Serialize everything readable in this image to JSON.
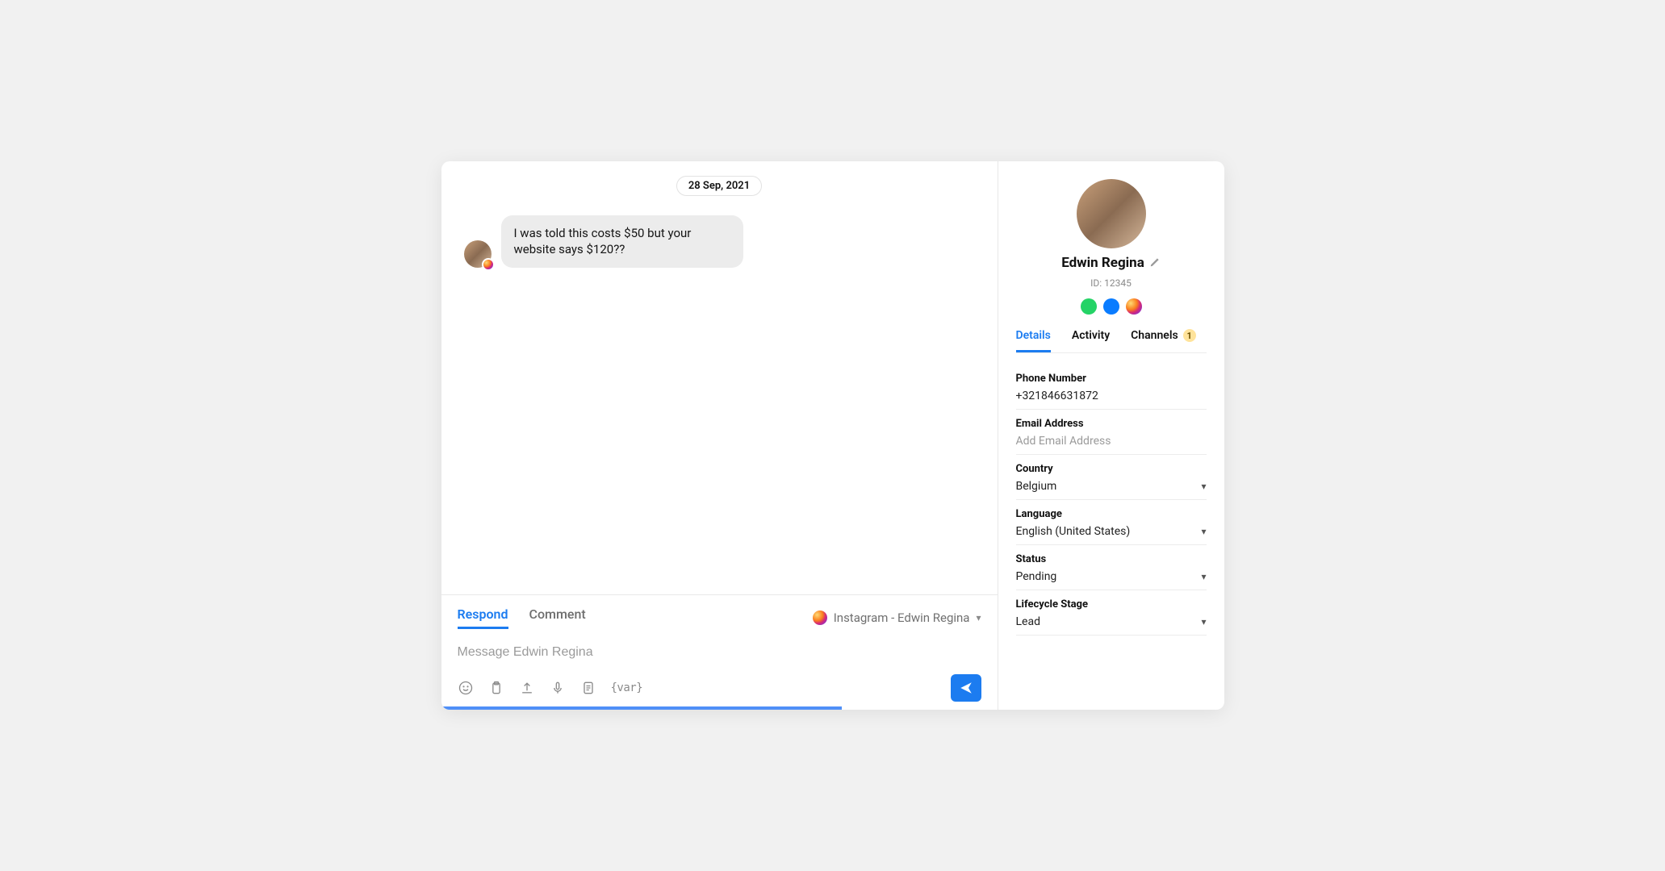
{
  "conversation": {
    "date": "28 Sep, 2021",
    "messages": [
      {
        "text": "I was told this costs $50 but your website says $120??",
        "source": "instagram"
      }
    ]
  },
  "composer": {
    "tabs": {
      "respond": "Respond",
      "comment": "Comment"
    },
    "active_tab": "respond",
    "channel_label": "Instagram - Edwin Regina",
    "placeholder": "Message Edwin Regina",
    "var_token": "{var}"
  },
  "contact": {
    "name": "Edwin Regina",
    "id_label": "ID: 12345",
    "channels": [
      "whatsapp",
      "messenger",
      "instagram"
    ]
  },
  "sidebar": {
    "tabs": {
      "details": "Details",
      "activity": "Activity",
      "channels": "Channels",
      "channels_badge": "1"
    },
    "fields": {
      "phone": {
        "label": "Phone Number",
        "value": "+321846631872"
      },
      "email": {
        "label": "Email Address",
        "placeholder": "Add Email Address"
      },
      "country": {
        "label": "Country",
        "value": "Belgium"
      },
      "language": {
        "label": "Language",
        "value": "English (United States)"
      },
      "status": {
        "label": "Status",
        "value": "Pending"
      },
      "lifecycle": {
        "label": "Lifecycle Stage",
        "value": "Lead"
      }
    }
  }
}
